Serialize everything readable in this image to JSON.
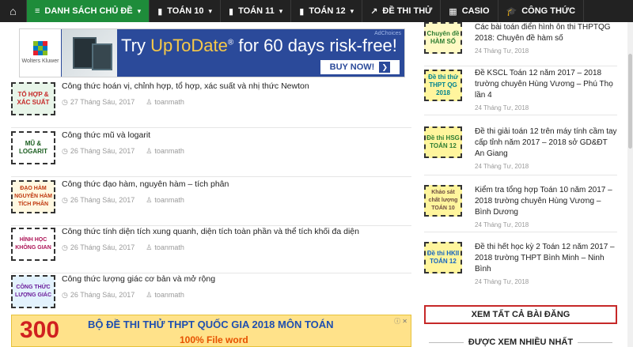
{
  "nav": {
    "items": [
      {
        "label": "DANH SÁCH CHỦ ĐỀ",
        "icon": "list-icon",
        "caret": "▾",
        "active": true
      },
      {
        "label": "TOÁN 10",
        "icon": "book-icon",
        "caret": "▾"
      },
      {
        "label": "TOÁN 11",
        "icon": "book-icon",
        "caret": "▾"
      },
      {
        "label": "TOÁN 12",
        "icon": "book-icon",
        "caret": "▾"
      },
      {
        "label": "ĐỀ THI THỬ",
        "icon": "external-link-icon"
      },
      {
        "label": "CASIO",
        "icon": "calculator-icon"
      },
      {
        "label": "CÔNG THỨC",
        "icon": "graduation-cap-icon"
      }
    ],
    "active_color": "#1e8c3a"
  },
  "ad_top": {
    "brand": "Wolters Kluwer",
    "headline_prefix": "Try ",
    "headline_brand": "UpToDate",
    "headline_reg": "®",
    "headline_suffix": " for 60 days risk-free!",
    "adchoices": "AdChoices",
    "cta": "BUY NOW!",
    "cta_arrow": "❯"
  },
  "posts": [
    {
      "title": "Công thức hoán vị, chỉnh hợp, tổ hợp, xác suất và nhị thức Newton",
      "date": "27 Tháng Sáu, 2017",
      "author": "toanmath",
      "thumb": "TỔ HỢP & XÁC SUẤT"
    },
    {
      "title": "Công thức mũ và logarit",
      "date": "26 Tháng Sáu, 2017",
      "author": "toanmath",
      "thumb": "MŨ & LOGARIT"
    },
    {
      "title": "Công thức đạo hàm, nguyên hàm – tích phân",
      "date": "26 Tháng Sáu, 2017",
      "author": "toanmath",
      "thumb": "ĐẠO HÀM NGUYÊN HÀM TÍCH PHÂN"
    },
    {
      "title": "Công thức tính diện tích xung quanh, diện tích toàn phần và thể tích khối đa diện",
      "date": "26 Tháng Sáu, 2017",
      "author": "toanmath",
      "thumb": "HÌNH HỌC KHÔNG GIAN"
    },
    {
      "title": "Công thức lượng giác cơ bản và mở rộng",
      "date": "26 Tháng Sáu, 2017",
      "author": "toanmath",
      "thumb": "CÔNG THỨC LƯỢNG GIÁC"
    }
  ],
  "ad_bottom": {
    "number": "300",
    "line1": "BỘ ĐỀ THI THỬ THPT QUỐC GIA 2018 MÔN TOÁN",
    "line2": "100% File word",
    "close": "ⓘ ✕"
  },
  "sidebar": {
    "items": [
      {
        "title": "Các bài toán điển hình ôn thi THPTQG 2018: Chuyên đề hàm số",
        "date": "24 Tháng Tư, 2018",
        "thumb": "Chuyên đề HÀM SỐ"
      },
      {
        "title": "Đề KSCL Toán 12 năm 2017 – 2018 trường chuyên Hùng Vương – Phú Thọ lần 4",
        "date": "24 Tháng Tư, 2018",
        "thumb": "Đề thi thử THPT QG 2018"
      },
      {
        "title": "Đề thi giải toán 12 trên máy tính cầm tay cấp tỉnh năm 2017 – 2018 sở GD&ĐT An Giang",
        "date": "24 Tháng Tư, 2018",
        "thumb": "Đề thi HSG TOÁN 12"
      },
      {
        "title": "Kiểm tra tổng hợp Toán 10 năm 2017 – 2018 trường chuyên Hùng Vương – Bình Dương",
        "date": "24 Tháng Tư, 2018",
        "thumb": "Khảo sát chất lượng TOÁN 10"
      },
      {
        "title": "Đề thi hết học kỳ 2 Toán 12 năm 2017 – 2018 trường THPT Bình Minh – Ninh Bình",
        "date": "24 Tháng Tư, 2018",
        "thumb": "Đề thi HKII TOÁN 12"
      }
    ],
    "see_all": "XEM TẤT CẢ BÀI ĐĂNG",
    "most_viewed": "ĐƯỢC XEM NHIỀU NHẤT"
  },
  "icons": {
    "home": "⌂",
    "list": "≡",
    "book": "▮",
    "ext": "↗",
    "calc": "▦",
    "cap": "🎓",
    "clock": "◷",
    "user": "♙"
  }
}
